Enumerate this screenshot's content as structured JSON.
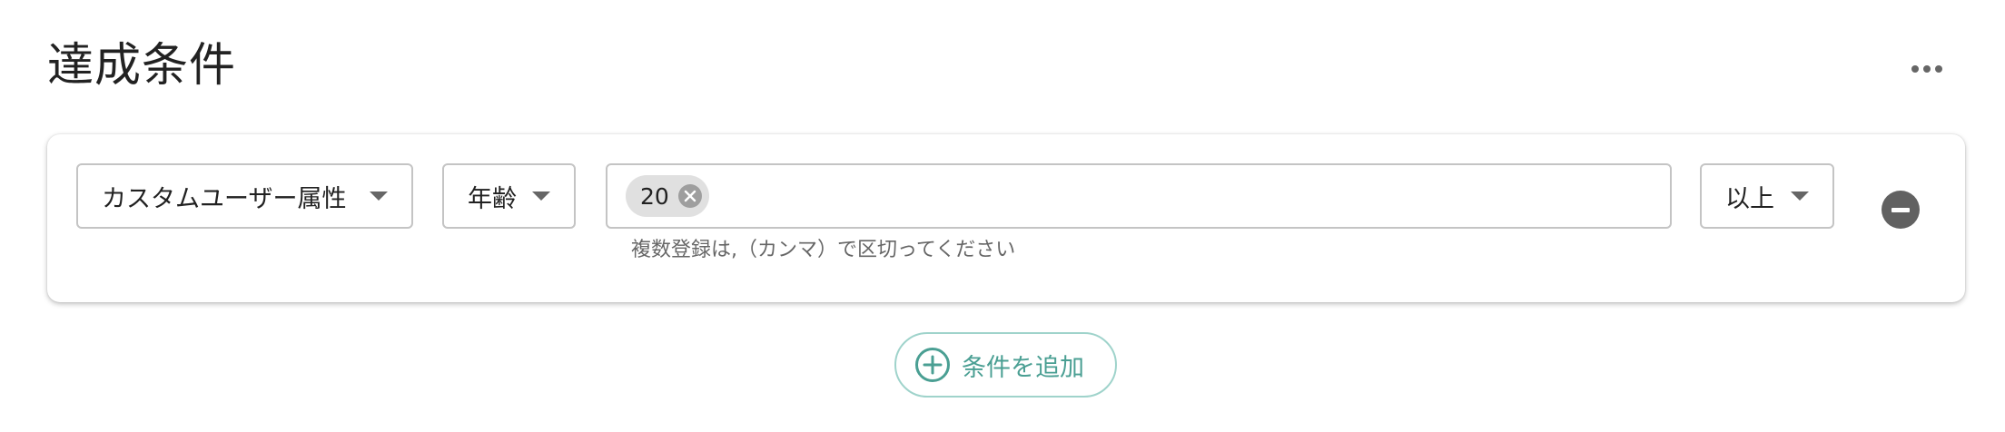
{
  "section": {
    "title": "達成条件",
    "more_icon": "more-horizontal-icon"
  },
  "condition": {
    "attribute_select": {
      "value": "カスタムユーザー属性"
    },
    "field_select": {
      "value": "年齢"
    },
    "value_input": {
      "chips": [
        "20"
      ],
      "helper_text": "複数登録は,（カンマ）で区切ってください"
    },
    "operator_select": {
      "value": "以上"
    },
    "remove_icon": "remove-circle-icon"
  },
  "add_condition": {
    "label": "条件を追加",
    "icon": "add-circle-outline-icon"
  },
  "colors": {
    "accent": "#4a9f93",
    "accent_border": "#9fd3cb",
    "icon_gray": "#616161"
  }
}
